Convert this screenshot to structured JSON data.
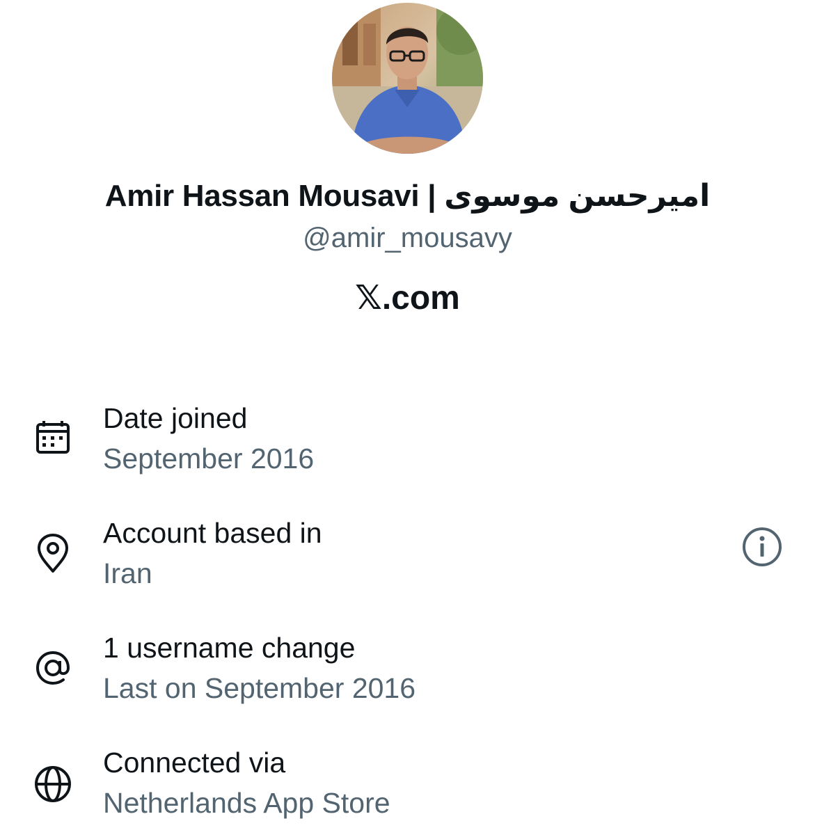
{
  "profile": {
    "display_name": "Amir Hassan Mousavi | امیرحسن موسوی",
    "handle": "@amir_mousavy",
    "site_label": "𝕏.com"
  },
  "details": [
    {
      "icon": "calendar-icon",
      "title": "Date joined",
      "value": "September 2016"
    },
    {
      "icon": "location-pin-icon",
      "title": "Account based in",
      "value": "Iran"
    },
    {
      "icon": "at-sign-icon",
      "title": "1 username change",
      "value": "Last on September 2016"
    },
    {
      "icon": "globe-icon",
      "title": "Connected via",
      "value": "Netherlands App Store"
    }
  ],
  "colors": {
    "primary_text": "#0f1419",
    "secondary_text": "#536471",
    "background": "#ffffff"
  }
}
